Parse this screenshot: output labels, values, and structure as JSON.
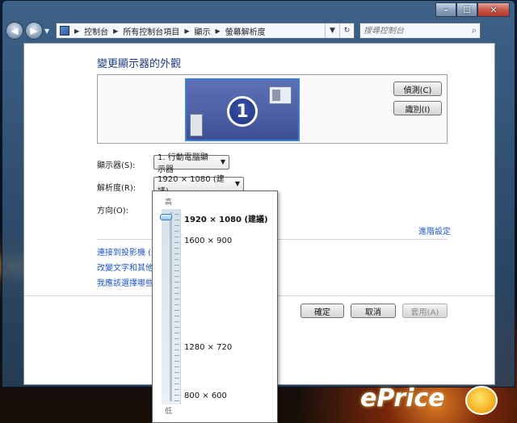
{
  "window": {
    "caption_buttons": {
      "minimize": "–",
      "maximize": "☐",
      "close": "✕"
    }
  },
  "navbar": {
    "back": "◀",
    "forward": "▶",
    "breadcrumbs": [
      "控制台",
      "所有控制台項目",
      "顯示",
      "螢幕解析度"
    ],
    "search_placeholder": "搜尋控制台"
  },
  "page": {
    "title": "變更顯示器的外觀",
    "monitor_number": "1",
    "detect_button": "偵測(C)",
    "identify_button": "識別(I)",
    "display_label": "顯示器(S):",
    "display_value": "1. 行動電腦顯示器",
    "resolution_label": "解析度(R):",
    "resolution_value": "1920 × 1080 (建議)",
    "orientation_label": "方向(O):",
    "advanced_link": "進階設定",
    "links": [
      "連接到投影機 (或",
      "改變文字和其他項",
      "我應該選擇哪些顯"
    ],
    "ok_button": "確定",
    "cancel_button": "取消",
    "apply_button": "套用(A)"
  },
  "resolution_dropdown": {
    "high_label": "高",
    "low_label": "低",
    "options": [
      "1920 × 1080 (建議)",
      "1600 × 900",
      "1280 × 720",
      "800 × 600"
    ],
    "selected": "1920 × 1080 (建議)"
  },
  "watermark": {
    "text": "ePrice"
  }
}
